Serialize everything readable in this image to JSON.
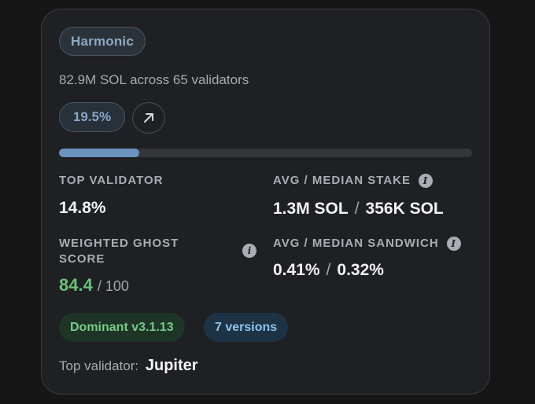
{
  "validator_group": {
    "name": "Harmonic",
    "summary": "82.9M SOL across 65 validators",
    "share_percent": "19.5%",
    "share_fraction": 0.195
  },
  "stats": {
    "top_validator": {
      "label": "TOP VALIDATOR",
      "value": "14.8%"
    },
    "avg_median_stake": {
      "label": "AVG / MEDIAN STAKE",
      "avg": "1.3M SOL",
      "separator": "/",
      "median": "356K SOL"
    },
    "weighted_ghost_score": {
      "label": "WEIGHTED GHOST SCORE",
      "value": "84.4",
      "max": "/ 100"
    },
    "avg_median_sandwich": {
      "label": "AVG / MEDIAN SANDWICH",
      "avg": "0.41%",
      "separator": "/",
      "median": "0.32%"
    }
  },
  "badges": {
    "dominant": "Dominant v3.1.13",
    "versions": "7 versions"
  },
  "top_validator_line": {
    "prefix": "Top validator:",
    "name": "Jupiter"
  },
  "icons": {
    "open": "arrow-up-right-icon",
    "info": "info-icon"
  },
  "colors": {
    "accent_blue": "#6a93bd",
    "score_green": "#69c17a",
    "dominant_green": "#79c98a",
    "versions_blue": "#8ec2ec"
  }
}
